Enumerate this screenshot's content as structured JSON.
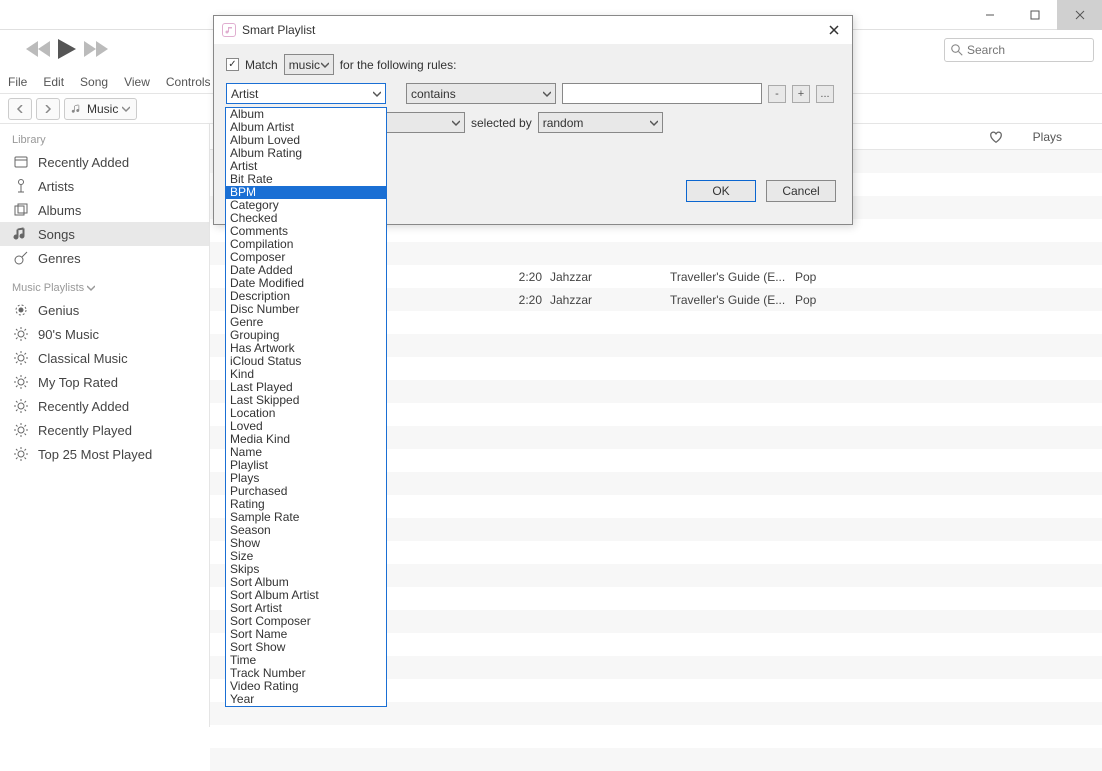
{
  "titlebar": {
    "minimize": "—",
    "maximize": "❐",
    "close": "✕"
  },
  "menubar": [
    "File",
    "Edit",
    "Song",
    "View",
    "Controls"
  ],
  "media_selector": "Music",
  "search": {
    "placeholder": "Search"
  },
  "sidebar": {
    "library_header": "Library",
    "library": [
      "Recently Added",
      "Artists",
      "Albums",
      "Songs",
      "Genres"
    ],
    "playlists_header": "Music Playlists",
    "playlists": [
      "Genius",
      "90's Music",
      "Classical Music",
      "My Top Rated",
      "Recently Added",
      "Recently Played",
      "Top 25 Most Played"
    ]
  },
  "columns": {
    "plays": "Plays"
  },
  "tracks": [
    {
      "time": "2:20",
      "artist": "Jahzzar",
      "album": "Traveller's Guide (E...",
      "genre": "Pop"
    },
    {
      "time": "2:20",
      "artist": "Jahzzar",
      "album": "Traveller's Guide (E...",
      "genre": "Pop"
    }
  ],
  "dialog": {
    "title": "Smart Playlist",
    "match_label": "Match",
    "match_type": "music",
    "suffix": "for the following rules:",
    "field_selected": "Artist",
    "condition": "contains",
    "input_value": "",
    "minus": "-",
    "plus": "+",
    "ellipsis": "...",
    "selected_by_label": "selected by",
    "selected_by_value": "random",
    "ok": "OK",
    "cancel": "Cancel"
  },
  "field_options": [
    "Album",
    "Album Artist",
    "Album Loved",
    "Album Rating",
    "Artist",
    "Bit Rate",
    "BPM",
    "Category",
    "Checked",
    "Comments",
    "Compilation",
    "Composer",
    "Date Added",
    "Date Modified",
    "Description",
    "Disc Number",
    "Genre",
    "Grouping",
    "Has Artwork",
    "iCloud Status",
    "Kind",
    "Last Played",
    "Last Skipped",
    "Location",
    "Loved",
    "Media Kind",
    "Name",
    "Playlist",
    "Plays",
    "Purchased",
    "Rating",
    "Sample Rate",
    "Season",
    "Show",
    "Size",
    "Skips",
    "Sort Album",
    "Sort Album Artist",
    "Sort Artist",
    "Sort Composer",
    "Sort Name",
    "Sort Show",
    "Time",
    "Track Number",
    "Video Rating",
    "Year"
  ],
  "field_highlight": "BPM"
}
